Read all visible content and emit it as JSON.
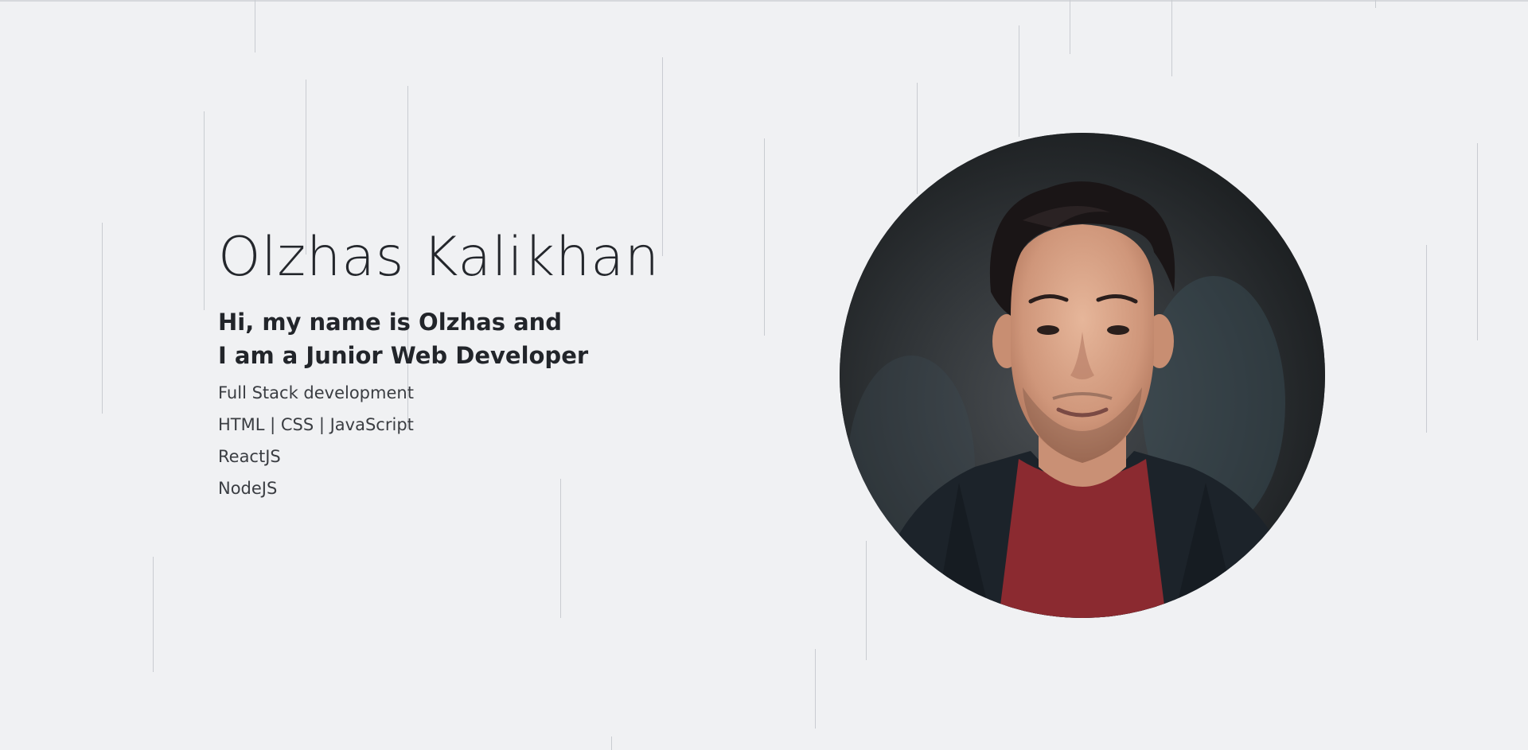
{
  "hero": {
    "name": "Olzhas Kalikhan",
    "intro_line1": "Hi, my name is Olzhas and",
    "intro_line2": "I am a Junior Web Developer",
    "skills": [
      "Full Stack development",
      "HTML | CSS | JavaScript",
      "ReactJS",
      "NodeJS"
    ]
  },
  "colors": {
    "background": "#f0f1f3",
    "text": "#23262b",
    "accent_shirt": "#8b2a30"
  },
  "icons": {
    "avatar": "profile-photo"
  }
}
